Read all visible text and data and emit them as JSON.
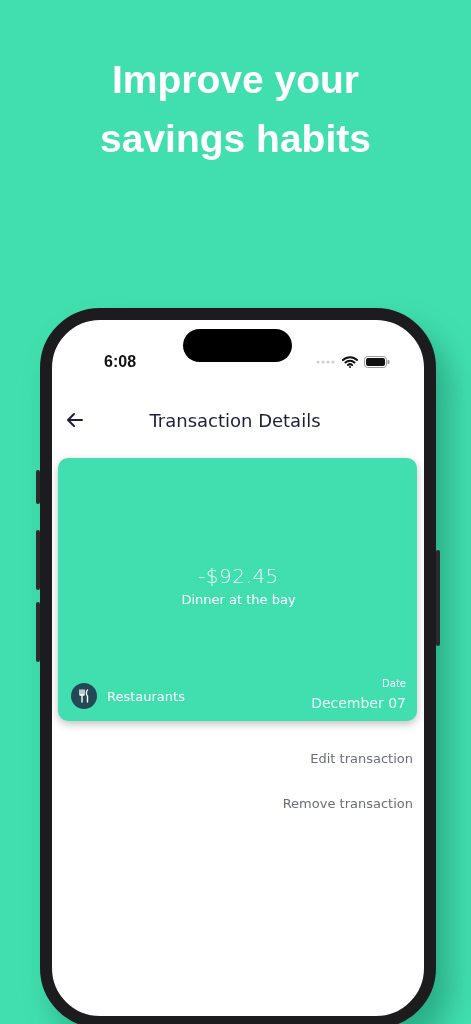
{
  "headline": "Improve your savings habits",
  "status_bar": {
    "time": "6:08"
  },
  "nav": {
    "title": "Transaction Details"
  },
  "card": {
    "amount": "-$92.45",
    "description": "Dinner at the bay",
    "category": "Restaurants",
    "date_label": "Date",
    "date": "December 07"
  },
  "actions": [
    "Edit transaction",
    "Remove transaction"
  ]
}
